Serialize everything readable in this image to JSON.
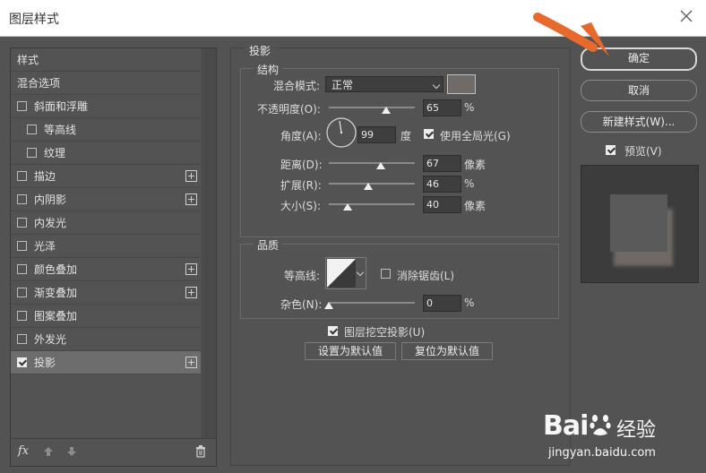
{
  "window": {
    "title": "图层样式"
  },
  "sidebar": {
    "items": [
      {
        "label": "样式",
        "checkbox": false,
        "checked": false,
        "indent": false,
        "plus": false,
        "selected": false
      },
      {
        "label": "混合选项",
        "checkbox": false,
        "checked": false,
        "indent": false,
        "plus": false,
        "selected": false
      },
      {
        "label": "斜面和浮雕",
        "checkbox": true,
        "checked": false,
        "indent": false,
        "plus": false,
        "selected": false
      },
      {
        "label": "等高线",
        "checkbox": true,
        "checked": false,
        "indent": true,
        "plus": false,
        "selected": false
      },
      {
        "label": "纹理",
        "checkbox": true,
        "checked": false,
        "indent": true,
        "plus": false,
        "selected": false
      },
      {
        "label": "描边",
        "checkbox": true,
        "checked": false,
        "indent": false,
        "plus": true,
        "selected": false
      },
      {
        "label": "内阴影",
        "checkbox": true,
        "checked": false,
        "indent": false,
        "plus": true,
        "selected": false
      },
      {
        "label": "内发光",
        "checkbox": true,
        "checked": false,
        "indent": false,
        "plus": false,
        "selected": false
      },
      {
        "label": "光泽",
        "checkbox": true,
        "checked": false,
        "indent": false,
        "plus": false,
        "selected": false
      },
      {
        "label": "颜色叠加",
        "checkbox": true,
        "checked": false,
        "indent": false,
        "plus": true,
        "selected": false
      },
      {
        "label": "渐变叠加",
        "checkbox": true,
        "checked": false,
        "indent": false,
        "plus": true,
        "selected": false
      },
      {
        "label": "图案叠加",
        "checkbox": true,
        "checked": false,
        "indent": false,
        "plus": false,
        "selected": false
      },
      {
        "label": "外发光",
        "checkbox": true,
        "checked": false,
        "indent": false,
        "plus": false,
        "selected": false
      },
      {
        "label": "投影",
        "checkbox": true,
        "checked": true,
        "indent": false,
        "plus": true,
        "selected": true
      }
    ],
    "footer": {
      "fx_label": "fx"
    }
  },
  "drop_shadow": {
    "section_title": "投影",
    "structure": {
      "title": "结构",
      "blend_mode_label": "混合模式:",
      "blend_mode_value": "正常",
      "shadow_color": "#6e6b69",
      "opacity_label": "不透明度(O):",
      "opacity_value": "65",
      "opacity_unit": "%",
      "angle_label": "角度(A):",
      "angle_value": "99",
      "angle_unit": "度",
      "global_light_label": "使用全局光(G)",
      "global_light_checked": true,
      "distance_label": "距离(D):",
      "distance_value": "67",
      "distance_unit": "像素",
      "spread_label": "扩展(R):",
      "spread_value": "46",
      "spread_unit": "%",
      "size_label": "大小(S):",
      "size_value": "40",
      "size_unit": "像素"
    },
    "quality": {
      "title": "品质",
      "contour_label": "等高线:",
      "antialias_label": "消除锯齿(L)",
      "antialias_checked": false,
      "noise_label": "杂色(N):",
      "noise_value": "0",
      "noise_unit": "%"
    },
    "knockout_label": "图层挖空投影(U)",
    "knockout_checked": true,
    "make_default_label": "设置为默认值",
    "reset_default_label": "复位为默认值"
  },
  "right": {
    "ok_label": "确定",
    "cancel_label": "取消",
    "new_style_label": "新建样式(W)...",
    "preview_label": "预览(V)",
    "preview_checked": true
  },
  "watermark": {
    "brand_text": "Bai",
    "brand_text2": "du",
    "brand_cn": "经验",
    "url": "jingyan.baidu.com"
  },
  "colors": {
    "dialog_bg": "#535353",
    "arrow": "#e8692c"
  }
}
